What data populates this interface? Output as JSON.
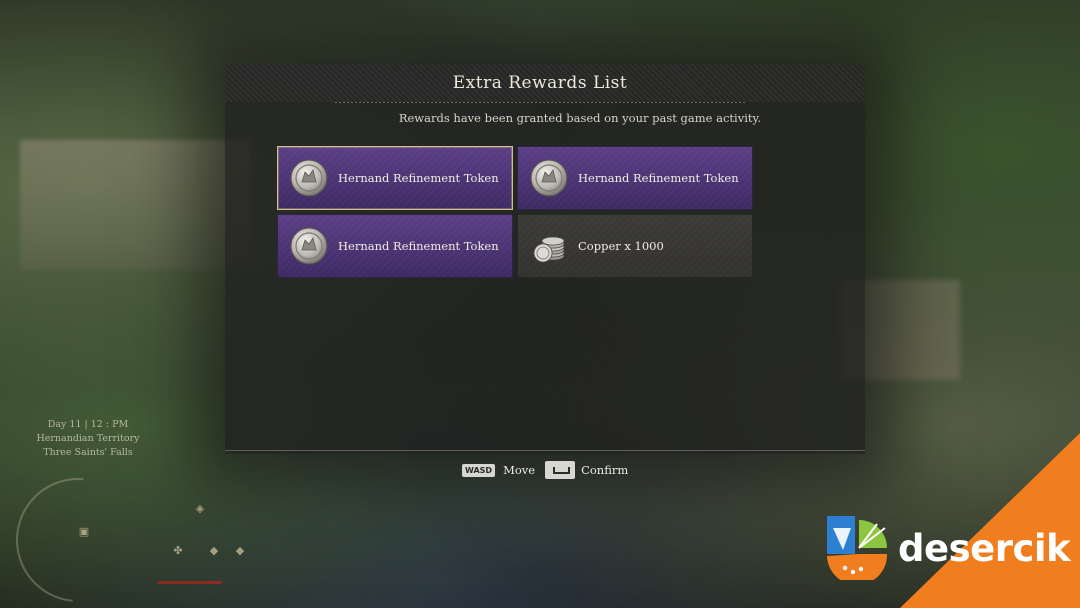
{
  "dialog": {
    "title": "Extra Rewards List",
    "subtitle": "Rewards have been granted based on your past game activity."
  },
  "rewards": [
    {
      "name": "Hernand Refinement Token",
      "icon": "hernand-token-icon",
      "rarity": "purple",
      "selected": true
    },
    {
      "name": "Hernand Refinement Token",
      "icon": "hernand-token-icon",
      "rarity": "purple",
      "selected": false
    },
    {
      "name": "Hernand Refinement Token",
      "icon": "hernand-token-icon",
      "rarity": "purple",
      "selected": false
    },
    {
      "name": "Copper x 1000",
      "icon": "copper-coins-icon",
      "rarity": "common",
      "selected": false
    }
  ],
  "controls": {
    "move_key": "WASD",
    "move_label": "Move",
    "confirm_key": "space-key-icon",
    "confirm_label": "Confirm"
  },
  "hud": {
    "time": "Day 11 | 12 : PM",
    "region": "Hernandian Territory",
    "location": "Three Saints' Falls"
  },
  "watermark": {
    "brand": "desercik"
  },
  "colors": {
    "purple_card": "#4a3272",
    "selected_border": "#cfc08c",
    "common_card": "#35342f",
    "watermark_orange": "#f07d1e"
  }
}
